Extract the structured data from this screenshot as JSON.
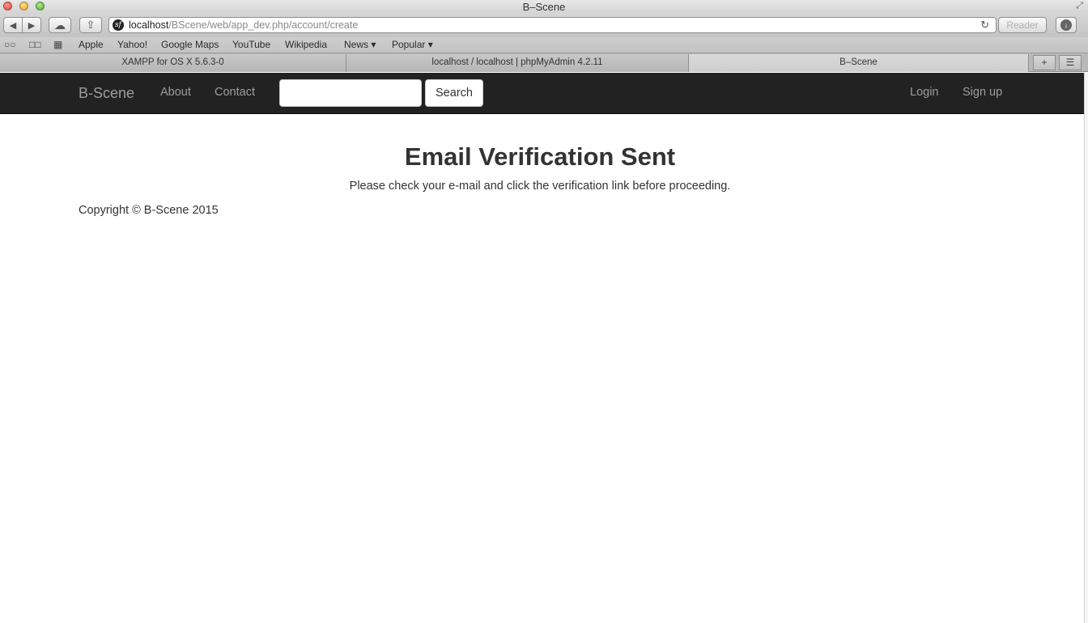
{
  "window": {
    "title": "B–Scene",
    "fullscreen_icon": "fullscreen-arrows-icon"
  },
  "toolbar": {
    "back_icon": "◀",
    "forward_icon": "▶",
    "icloud_icon": "☁",
    "share_icon": "⇪",
    "url_host": "localhost",
    "url_path": "/BScene/web/app_dev.php/account/create",
    "reload_icon": "↻",
    "reader_label": "Reader",
    "download_icon": "↓",
    "favicon": "sf"
  },
  "bookmarks": {
    "reading_list_icon": "○○",
    "bookmarks_icon": "📖",
    "top_sites_icon": "▦",
    "items": [
      "Apple",
      "Yahoo!",
      "Google Maps",
      "YouTube",
      "Wikipedia",
      "News ▾",
      "Popular ▾"
    ]
  },
  "tabs": [
    {
      "label": "XAMPP for OS X 5.6.3-0"
    },
    {
      "label": "localhost / localhost | phpMyAdmin 4.2.11"
    },
    {
      "label": "B–Scene"
    }
  ],
  "tab_controls": {
    "new_tab": "+",
    "overview": "☰"
  },
  "navbar": {
    "brand": "B-Scene",
    "about": "About",
    "contact": "Contact",
    "search_value": "",
    "search_button": "Search",
    "login": "Login",
    "signup": "Sign up"
  },
  "content": {
    "heading": "Email Verification Sent",
    "message": "Please check your e-mail and click the verification link before proceeding.",
    "copyright": "Copyright © B-Scene 2015"
  }
}
